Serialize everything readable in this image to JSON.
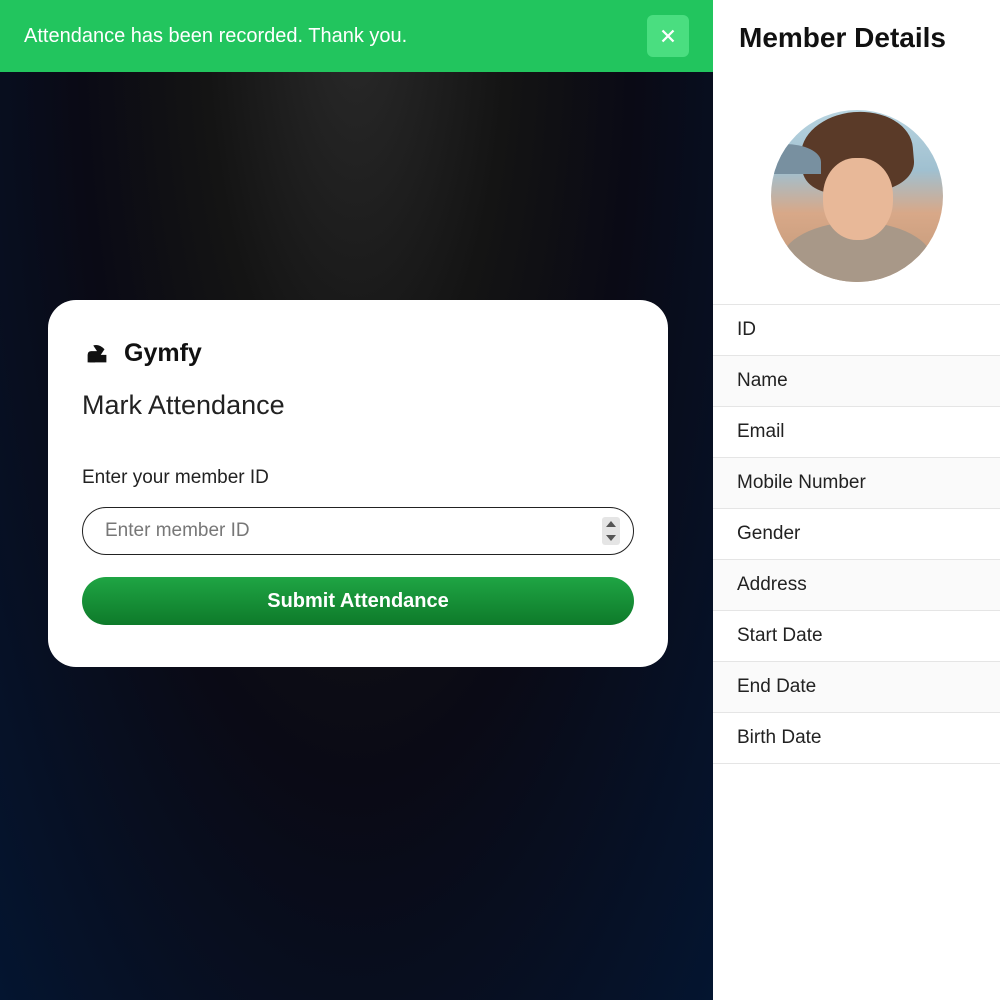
{
  "toast": {
    "message": "Attendance has been recorded. Thank you."
  },
  "card": {
    "brand": "Gymfy",
    "title": "Mark Attendance",
    "input_label": "Enter your member ID",
    "input_placeholder": "Enter member ID",
    "submit_label": "Submit Attendance"
  },
  "sidebar": {
    "title": "Member Details",
    "fields": [
      "ID",
      "Name",
      "Email",
      "Mobile Number",
      "Gender",
      "Address",
      "Start Date",
      "End Date",
      "Birth Date"
    ]
  },
  "colors": {
    "success": "#22c55e",
    "submit_button": "#168a36"
  }
}
